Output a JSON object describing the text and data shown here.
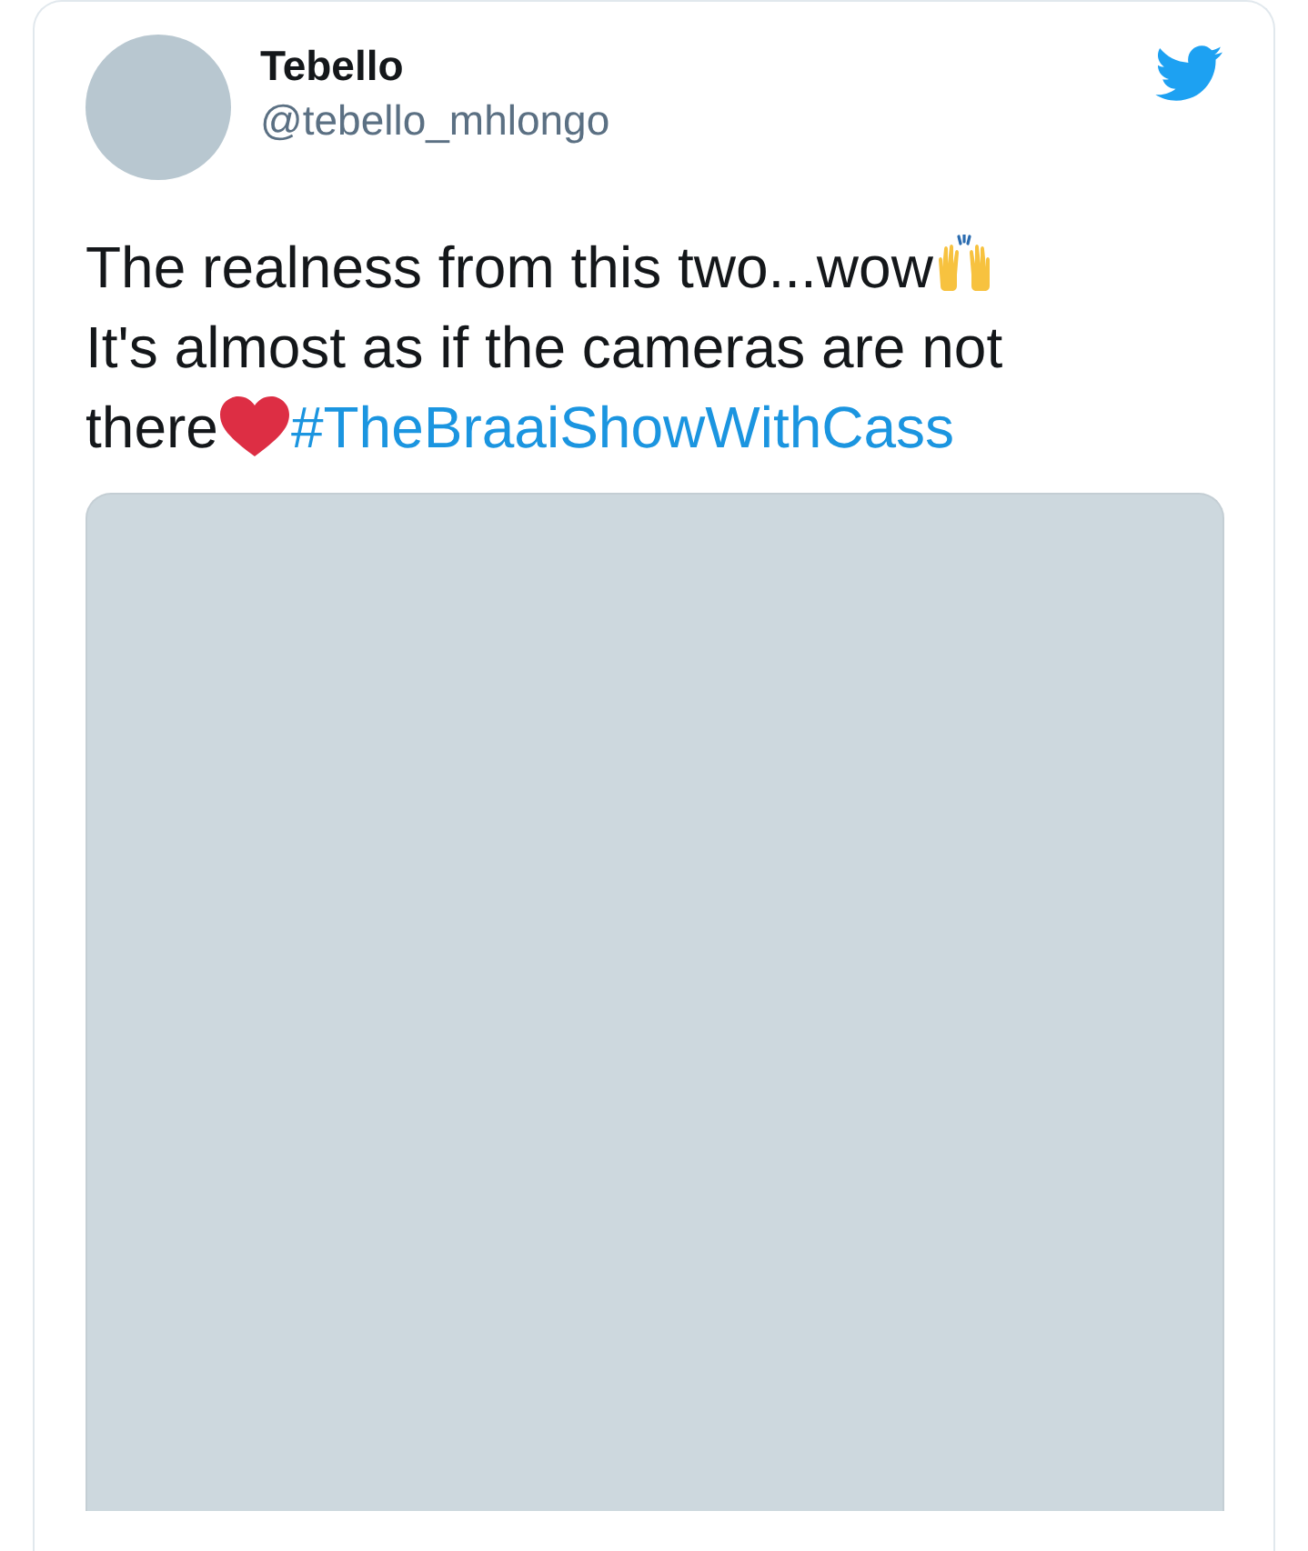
{
  "tweet": {
    "author": {
      "name": "Tebello",
      "handle": "@tebello_mhlongo"
    },
    "lines": [
      [
        {
          "kind": "text",
          "text": "The realness from this two...wow"
        },
        {
          "kind": "hands-emoji"
        }
      ],
      [
        {
          "kind": "text",
          "text": "It's almost as if the cameras are not"
        }
      ],
      [
        {
          "kind": "text",
          "text": "there"
        },
        {
          "kind": "heart-emoji"
        },
        {
          "kind": "hashtag",
          "text": "#TheBraaiShowWithCass"
        }
      ]
    ],
    "media": {
      "kind": "placeholder"
    }
  }
}
